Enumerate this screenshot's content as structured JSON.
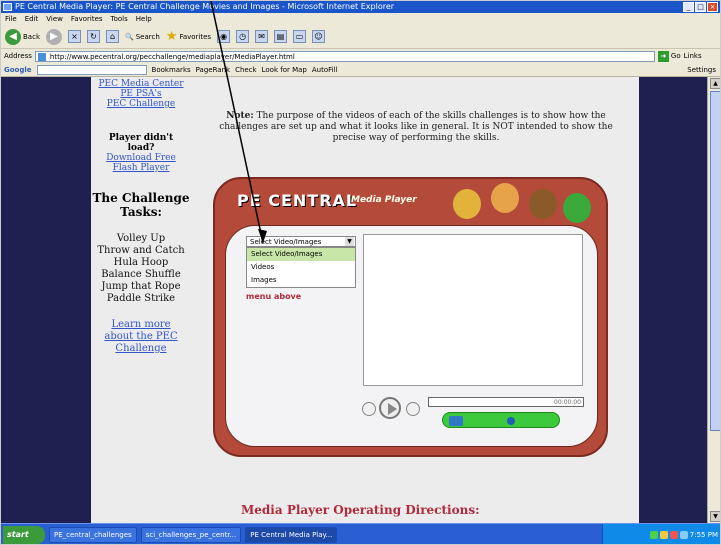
{
  "window": {
    "title": "PE Central Media Player: PE Central Challenge Movies and Images - Microsoft Internet Explorer",
    "buttons": [
      "_",
      "□",
      "×"
    ]
  },
  "menubar": [
    "File",
    "Edit",
    "View",
    "Favorites",
    "Tools",
    "Help"
  ],
  "toolbar": {
    "back": "Back",
    "search": "Search",
    "favorites": "Favorites"
  },
  "address": {
    "label": "Address",
    "url": "http://www.pecentral.org/pecchallenge/mediaplayer/MediaPlayer.html",
    "go": "Go",
    "links": "Links"
  },
  "googlebar": {
    "logo": "Google",
    "bookmarks": "Bookmarks",
    "pagerank": "PageRank",
    "check": "Check",
    "look_for_map": "Look for Map",
    "autofill": "AutoFill",
    "settings": "Settings"
  },
  "sidebar": {
    "links": [
      "PEC Media Center",
      "PE PSA's",
      "PEC Challenge"
    ],
    "player_help": "Player didn't load?",
    "download_link": "Download Free Flash Player",
    "challenge_title": "The Challenge Tasks:",
    "tasks": [
      "Volley Up",
      "Throw and Catch",
      "Hula Hoop",
      "Balance Shuffle",
      "Jump that Rope",
      "Paddle Strike"
    ],
    "learn_more": "Learn more about the PEC Challenge"
  },
  "main": {
    "note_bold": "Note:",
    "note_text": "The purpose of the videos of each of the skills challenges is to show how the challenges are set up and what it looks like in general. It is NOT intended to show the precise way of performing the skills.",
    "directions": "Media Player Operating Directions:"
  },
  "player": {
    "logo": "PE CENTRAL",
    "subtitle": "Media Player",
    "select_value": "Select Video/Images",
    "options": [
      "Select Video/Images",
      "Videos",
      "Images"
    ],
    "menu_above": "menu above",
    "time": "00:00:00"
  },
  "taskbar": {
    "start": "start",
    "items": [
      "PE_central_challenges",
      "sci_challenges_pe_centr...",
      "PE Central Media Play..."
    ],
    "clock": "7:55 PM"
  },
  "colors": {
    "page_bg": "#1f2050",
    "player_red": "#b34a3a",
    "link_blue": "#3355cc",
    "accent_red": "#b3283a",
    "volume_green": "#3cc93c"
  }
}
